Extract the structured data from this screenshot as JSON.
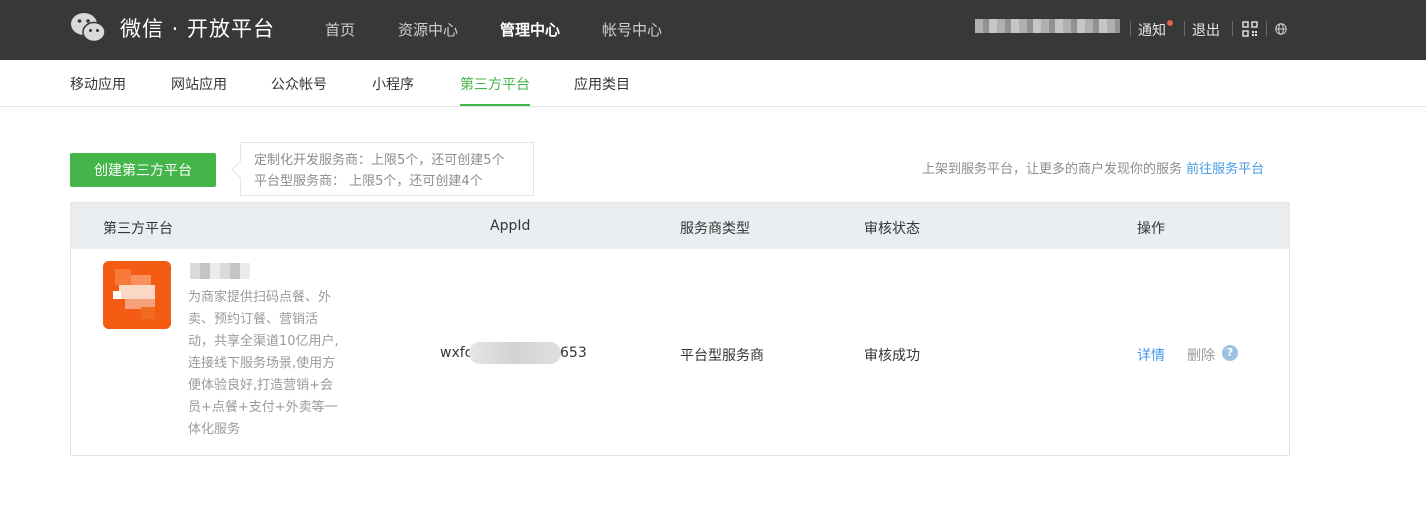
{
  "header": {
    "brand": "微信 · 开放平台",
    "nav": [
      "首页",
      "资源中心",
      "管理中心",
      "帐号中心"
    ],
    "active_nav": "管理中心",
    "notice_label": "通知",
    "logout_label": "退出"
  },
  "subnav": {
    "items": [
      "移动应用",
      "网站应用",
      "公众帐号",
      "小程序",
      "第三方平台",
      "应用类目"
    ],
    "active": "第三方平台"
  },
  "toolbar": {
    "create_label": "创建第三方平台",
    "tip_line1": "定制化开发服务商：上限5个，还可创建5个",
    "tip_line2": "平台型服务商： 上限5个，还可创建4个",
    "promo_text": "上架到服务平台，让更多的商户发现你的服务",
    "promo_link": "前往服务平台"
  },
  "table": {
    "headers": [
      "第三方平台",
      "AppId",
      "服务商类型",
      "审核状态",
      "操作"
    ],
    "row": {
      "description": "为商家提供扫码点餐、外卖、预约订餐、营销活动，共享全渠道10亿用户,连接线下服务场景,使用方便体验良好,打造营销+会员+点餐+支付+外卖等一体化服务",
      "appid_prefix": "wxfc",
      "appid_suffix": "653",
      "type": "平台型服务商",
      "status": "审核成功",
      "detail_label": "详情",
      "delete_label": "删除",
      "help_glyph": "?"
    }
  },
  "colors": {
    "topbar": "#383838",
    "accent_green": "#44b549",
    "link_blue": "#459ae9",
    "app_icon": "#f45b13"
  }
}
